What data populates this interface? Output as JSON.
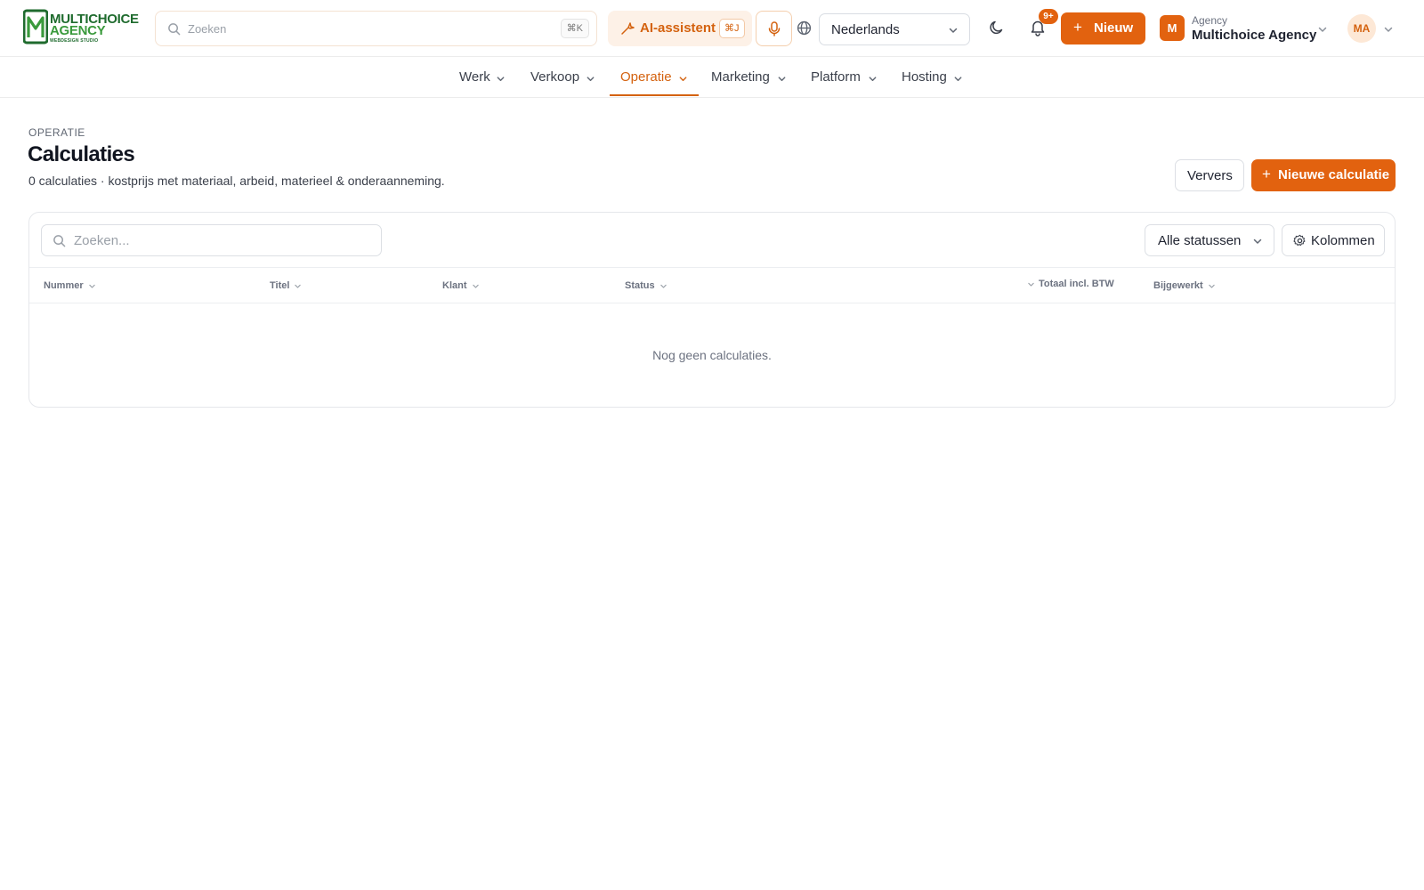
{
  "brand": {
    "line1": "MULTICHOICE",
    "line2": "AGENCY",
    "line3": "WEBDESIGN STUDIO",
    "accent": "#e2620f",
    "logo_green": "#1f6b2e"
  },
  "topbar": {
    "search_placeholder": "Zoeken",
    "search_shortcut": "⌘K",
    "ai_label": "AI-assistent",
    "ai_shortcut": "⌘J",
    "language": "Nederlands",
    "notifications_badge": "9+",
    "new_label": "Nieuw",
    "org_initial": "M",
    "org_type": "Agency",
    "org_name": "Multichoice Agency",
    "user_initials": "MA"
  },
  "nav": {
    "items": [
      {
        "label": "Werk"
      },
      {
        "label": "Verkoop"
      },
      {
        "label": "Operatie",
        "active": true
      },
      {
        "label": "Marketing"
      },
      {
        "label": "Platform"
      },
      {
        "label": "Hosting"
      }
    ]
  },
  "page": {
    "kicker": "OPERATIE",
    "title": "Calculaties",
    "subtitle": "0 calculaties · kostprijs met materiaal, arbeid, materieel & onderaanneming.",
    "refresh_label": "Ververs",
    "new_calc_label": "Nieuwe calculatie"
  },
  "table": {
    "search_placeholder": "Zoeken...",
    "status_filter": "Alle statussen",
    "columns_label": "Kolommen",
    "columns": [
      "Nummer",
      "Titel",
      "Klant",
      "Status",
      "Totaal incl. BTW",
      "Bijgewerkt"
    ],
    "empty_text": "Nog geen calculaties."
  }
}
